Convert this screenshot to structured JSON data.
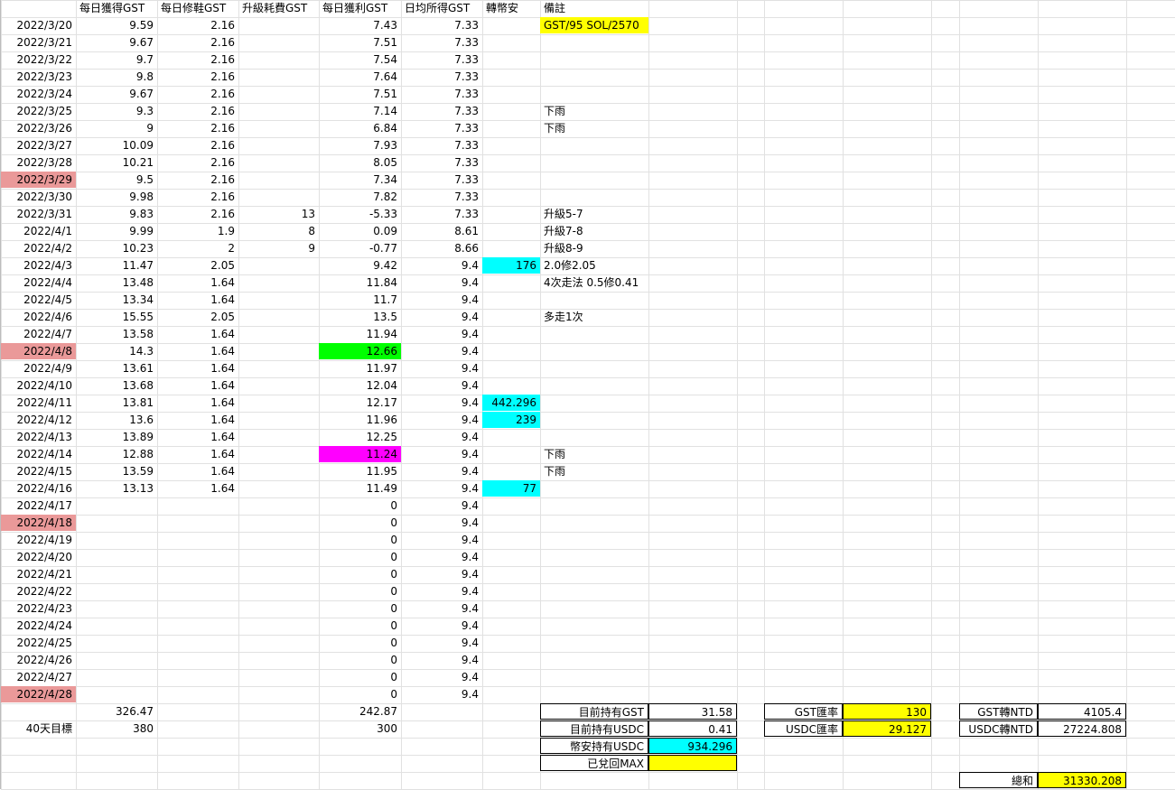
{
  "headers": [
    "",
    "每日獲得GST",
    "每日修鞋GST",
    "升級耗費GST",
    "每日獲利GST",
    "日均所得GST",
    "轉幣安",
    "備註"
  ],
  "rows": [
    {
      "date": "2022/3/20",
      "gain": "9.59",
      "repair": "2.16",
      "upgrade": "",
      "profit": "7.43",
      "avg": "7.33",
      "binance": "",
      "note": "GST/95  SOL/2570"
    },
    {
      "date": "2022/3/21",
      "gain": "9.67",
      "repair": "2.16",
      "upgrade": "",
      "profit": "7.51",
      "avg": "7.33",
      "binance": "",
      "note": ""
    },
    {
      "date": "2022/3/22",
      "gain": "9.7",
      "repair": "2.16",
      "upgrade": "",
      "profit": "7.54",
      "avg": "7.33",
      "binance": "",
      "note": ""
    },
    {
      "date": "2022/3/23",
      "gain": "9.8",
      "repair": "2.16",
      "upgrade": "",
      "profit": "7.64",
      "avg": "7.33",
      "binance": "",
      "note": ""
    },
    {
      "date": "2022/3/24",
      "gain": "9.67",
      "repair": "2.16",
      "upgrade": "",
      "profit": "7.51",
      "avg": "7.33",
      "binance": "",
      "note": ""
    },
    {
      "date": "2022/3/25",
      "gain": "9.3",
      "repair": "2.16",
      "upgrade": "",
      "profit": "7.14",
      "avg": "7.33",
      "binance": "",
      "note": "下雨"
    },
    {
      "date": "2022/3/26",
      "gain": "9",
      "repair": "2.16",
      "upgrade": "",
      "profit": "6.84",
      "avg": "7.33",
      "binance": "",
      "note": "下雨"
    },
    {
      "date": "2022/3/27",
      "gain": "10.09",
      "repair": "2.16",
      "upgrade": "",
      "profit": "7.93",
      "avg": "7.33",
      "binance": "",
      "note": ""
    },
    {
      "date": "2022/3/28",
      "gain": "10.21",
      "repair": "2.16",
      "upgrade": "",
      "profit": "8.05",
      "avg": "7.33",
      "binance": "",
      "note": ""
    },
    {
      "date": "2022/3/29",
      "gain": "9.5",
      "repair": "2.16",
      "upgrade": "",
      "profit": "7.34",
      "avg": "7.33",
      "binance": "",
      "note": ""
    },
    {
      "date": "2022/3/30",
      "gain": "9.98",
      "repair": "2.16",
      "upgrade": "",
      "profit": "7.82",
      "avg": "7.33",
      "binance": "",
      "note": ""
    },
    {
      "date": "2022/3/31",
      "gain": "9.83",
      "repair": "2.16",
      "upgrade": "13",
      "profit": "-5.33",
      "avg": "7.33",
      "binance": "",
      "note": "升級5-7"
    },
    {
      "date": "2022/4/1",
      "gain": "9.99",
      "repair": "1.9",
      "upgrade": "8",
      "profit": "0.09",
      "avg": "8.61",
      "binance": "",
      "note": "升級7-8"
    },
    {
      "date": "2022/4/2",
      "gain": "10.23",
      "repair": "2",
      "upgrade": "9",
      "profit": "-0.77",
      "avg": "8.66",
      "binance": "",
      "note": "升級8-9"
    },
    {
      "date": "2022/4/3",
      "gain": "11.47",
      "repair": "2.05",
      "upgrade": "",
      "profit": "9.42",
      "avg": "9.4",
      "binance": "176",
      "note": "2.0修2.05"
    },
    {
      "date": "2022/4/4",
      "gain": "13.48",
      "repair": "1.64",
      "upgrade": "",
      "profit": "11.84",
      "avg": "9.4",
      "binance": "",
      "note": "4次走法 0.5修0.41"
    },
    {
      "date": "2022/4/5",
      "gain": "13.34",
      "repair": "1.64",
      "upgrade": "",
      "profit": "11.7",
      "avg": "9.4",
      "binance": "",
      "note": ""
    },
    {
      "date": "2022/4/6",
      "gain": "15.55",
      "repair": "2.05",
      "upgrade": "",
      "profit": "13.5",
      "avg": "9.4",
      "binance": "",
      "note": "多走1次"
    },
    {
      "date": "2022/4/7",
      "gain": "13.58",
      "repair": "1.64",
      "upgrade": "",
      "profit": "11.94",
      "avg": "9.4",
      "binance": "",
      "note": ""
    },
    {
      "date": "2022/4/8",
      "gain": "14.3",
      "repair": "1.64",
      "upgrade": "",
      "profit": "12.66",
      "avg": "9.4",
      "binance": "",
      "note": ""
    },
    {
      "date": "2022/4/9",
      "gain": "13.61",
      "repair": "1.64",
      "upgrade": "",
      "profit": "11.97",
      "avg": "9.4",
      "binance": "",
      "note": ""
    },
    {
      "date": "2022/4/10",
      "gain": "13.68",
      "repair": "1.64",
      "upgrade": "",
      "profit": "12.04",
      "avg": "9.4",
      "binance": "",
      "note": ""
    },
    {
      "date": "2022/4/11",
      "gain": "13.81",
      "repair": "1.64",
      "upgrade": "",
      "profit": "12.17",
      "avg": "9.4",
      "binance": "442.296",
      "note": ""
    },
    {
      "date": "2022/4/12",
      "gain": "13.6",
      "repair": "1.64",
      "upgrade": "",
      "profit": "11.96",
      "avg": "9.4",
      "binance": "239",
      "note": ""
    },
    {
      "date": "2022/4/13",
      "gain": "13.89",
      "repair": "1.64",
      "upgrade": "",
      "profit": "12.25",
      "avg": "9.4",
      "binance": "",
      "note": ""
    },
    {
      "date": "2022/4/14",
      "gain": "12.88",
      "repair": "1.64",
      "upgrade": "",
      "profit": "11.24",
      "avg": "9.4",
      "binance": "",
      "note": "下雨"
    },
    {
      "date": "2022/4/15",
      "gain": "13.59",
      "repair": "1.64",
      "upgrade": "",
      "profit": "11.95",
      "avg": "9.4",
      "binance": "",
      "note": "下雨"
    },
    {
      "date": "2022/4/16",
      "gain": "13.13",
      "repair": "1.64",
      "upgrade": "",
      "profit": "11.49",
      "avg": "9.4",
      "binance": "77",
      "note": ""
    },
    {
      "date": "2022/4/17",
      "gain": "",
      "repair": "",
      "upgrade": "",
      "profit": "0",
      "avg": "9.4",
      "binance": "",
      "note": ""
    },
    {
      "date": "2022/4/18",
      "gain": "",
      "repair": "",
      "upgrade": "",
      "profit": "0",
      "avg": "9.4",
      "binance": "",
      "note": ""
    },
    {
      "date": "2022/4/19",
      "gain": "",
      "repair": "",
      "upgrade": "",
      "profit": "0",
      "avg": "9.4",
      "binance": "",
      "note": ""
    },
    {
      "date": "2022/4/20",
      "gain": "",
      "repair": "",
      "upgrade": "",
      "profit": "0",
      "avg": "9.4",
      "binance": "",
      "note": ""
    },
    {
      "date": "2022/4/21",
      "gain": "",
      "repair": "",
      "upgrade": "",
      "profit": "0",
      "avg": "9.4",
      "binance": "",
      "note": ""
    },
    {
      "date": "2022/4/22",
      "gain": "",
      "repair": "",
      "upgrade": "",
      "profit": "0",
      "avg": "9.4",
      "binance": "",
      "note": ""
    },
    {
      "date": "2022/4/23",
      "gain": "",
      "repair": "",
      "upgrade": "",
      "profit": "0",
      "avg": "9.4",
      "binance": "",
      "note": ""
    },
    {
      "date": "2022/4/24",
      "gain": "",
      "repair": "",
      "upgrade": "",
      "profit": "0",
      "avg": "9.4",
      "binance": "",
      "note": ""
    },
    {
      "date": "2022/4/25",
      "gain": "",
      "repair": "",
      "upgrade": "",
      "profit": "0",
      "avg": "9.4",
      "binance": "",
      "note": ""
    },
    {
      "date": "2022/4/26",
      "gain": "",
      "repair": "",
      "upgrade": "",
      "profit": "0",
      "avg": "9.4",
      "binance": "",
      "note": ""
    },
    {
      "date": "2022/4/27",
      "gain": "",
      "repair": "",
      "upgrade": "",
      "profit": "0",
      "avg": "9.4",
      "binance": "",
      "note": ""
    },
    {
      "date": "2022/4/28",
      "gain": "",
      "repair": "",
      "upgrade": "",
      "profit": "0",
      "avg": "9.4",
      "binance": "",
      "note": ""
    }
  ],
  "totals": {
    "gain": "326.47",
    "profit": "242.87"
  },
  "target": {
    "label": "40天目標",
    "gain": "380",
    "profit": "300"
  },
  "holdings": {
    "gst_label": "目前持有GST",
    "gst_value": "31.58",
    "usdc_label": "目前持有USDC",
    "usdc_value": "0.41",
    "binance_usdc_label": "幣安持有USDC",
    "binance_usdc_value": "934.296",
    "max_label": "已兌回MAX",
    "max_value": ""
  },
  "rates": {
    "gst_rate_label": "GST匯率",
    "gst_rate_value": "130",
    "usdc_rate_label": "USDC匯率",
    "usdc_rate_value": "29.127"
  },
  "ntd": {
    "gst_ntd_label": "GST轉NTD",
    "gst_ntd_value": "4105.4",
    "usdc_ntd_label": "USDC轉NTD",
    "usdc_ntd_value": "27224.808",
    "sum_label": "總和",
    "sum_value": "31330.208"
  },
  "highlights": {
    "pink_dates": [
      "2022/3/29",
      "2022/4/8",
      "2022/4/18",
      "2022/4/28"
    ],
    "green_profit_date": "2022/4/8",
    "magenta_profit_date": "2022/4/14",
    "colors": {
      "yellow": "#ffff00",
      "cyan": "#00ffff",
      "green": "#00ff00",
      "magenta": "#ff00ff",
      "pink": "#ea9999"
    }
  }
}
